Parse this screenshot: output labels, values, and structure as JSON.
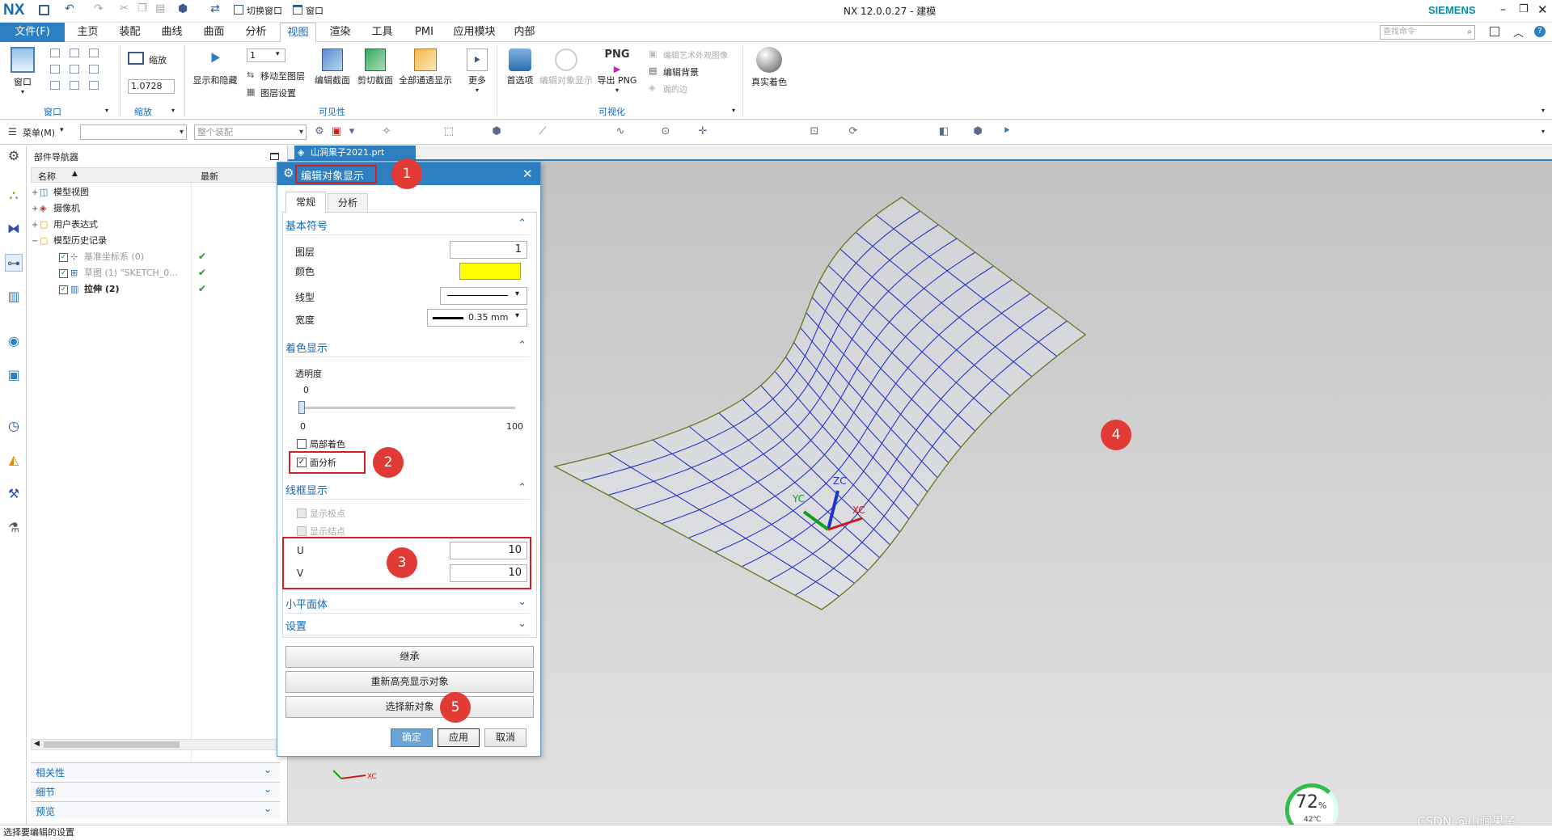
{
  "title_bar": {
    "logo": "NX",
    "window_title": "NX 12.0.0.27 - 建模",
    "brand": "SIEMENS",
    "switch_window": "切换窗口",
    "window_menu": "窗口",
    "search_placeholder": "查找命令"
  },
  "menu_tabs": [
    "文件(F)",
    "主页",
    "装配",
    "曲线",
    "曲面",
    "分析",
    "视图",
    "渲染",
    "工具",
    "PMI",
    "应用模块",
    "内部"
  ],
  "active_tab": "视图",
  "ribbon": {
    "window_label": "窗口",
    "group_window": "窗口",
    "zoom_label": "缩放",
    "zoom_value": "1.0728",
    "group_zoom": "缩放",
    "layer_value": "1",
    "show_hide": "显示和隐藏",
    "move_to_layer": "移动至图层",
    "layer_settings": "图层设置",
    "edit_section": "编辑截面",
    "clip_section": "剪切截面",
    "all_through": "全部通透显示",
    "more": "更多",
    "group_visibility": "可见性",
    "preferences": "首选项",
    "edit_obj_display": "编辑对象显示",
    "export_png": "导出 PNG",
    "png_icon_text": "PNG",
    "edit_art": "编辑艺术外观图像",
    "edit_background": "编辑背景",
    "face_edges": "面的边",
    "group_visualization": "可视化",
    "true_shading": "真实着色"
  },
  "toolbar2": {
    "menu_label": "菜单(M)",
    "filter_value": "",
    "assembly_scope": "整个装配"
  },
  "navigator": {
    "title": "部件导航器",
    "col_name": "名称",
    "col_latest": "最新",
    "rows": [
      {
        "label": "模型视图",
        "indent": 0,
        "check": false
      },
      {
        "label": "摄像机",
        "indent": 0,
        "check": false
      },
      {
        "label": "用户表达式",
        "indent": 0,
        "check": false
      },
      {
        "label": "模型历史记录",
        "indent": 0,
        "check": false
      },
      {
        "label": "基准坐标系 (0)",
        "indent": 1,
        "check": true
      },
      {
        "label": "草图 (1) \"SKETCH_0...",
        "indent": 1,
        "check": true
      },
      {
        "label": "拉伸 (2)",
        "indent": 1,
        "check": true
      }
    ],
    "bottom_panels": [
      "相关性",
      "细节",
      "预览"
    ]
  },
  "doc_tab": {
    "label": "山涧果子2021.prt"
  },
  "dialog": {
    "title": "编辑对象显示",
    "tabs": [
      "常规",
      "分析"
    ],
    "section_basic": "基本符号",
    "layer_label": "图层",
    "layer_value": "1",
    "color_label": "颜色",
    "color_value": "#ffff00",
    "linetype_label": "线型",
    "width_label": "宽度",
    "width_value": "0.35 mm",
    "section_shading": "着色显示",
    "transparency_label": "透明度",
    "transparency_value": "0",
    "transparency_fraction": 0,
    "slider_min": "0",
    "slider_max": "100",
    "partial_shading": "局部着色",
    "partial_shading_checked": false,
    "face_analysis": "面分析",
    "face_analysis_checked": true,
    "section_wireframe": "线框显示",
    "show_poles": "显示极点",
    "show_knots": "显示结点",
    "u_label": "U",
    "u_value": "10",
    "v_label": "V",
    "v_value": "10",
    "section_facet": "小平面体",
    "section_settings": "设置",
    "btn_inherit": "继承",
    "btn_rehighlight": "重新高亮显示对象",
    "btn_select_new": "选择新对象",
    "btn_ok": "确定",
    "btn_apply": "应用",
    "btn_cancel": "取消"
  },
  "annotations": [
    "1",
    "2",
    "3",
    "4",
    "5"
  ],
  "viewport": {
    "axis_x": "XC",
    "axis_y": "YC",
    "axis_z": "ZC",
    "mesh_color": "#2633c9",
    "edge_color": "#6e7a2a"
  },
  "gauge": {
    "percent": "72",
    "unit": "%",
    "temp": "42℃",
    "fraction": 0.72
  },
  "watermark": "CSDN @山涧果子",
  "status_text": "选择要编辑的设置"
}
